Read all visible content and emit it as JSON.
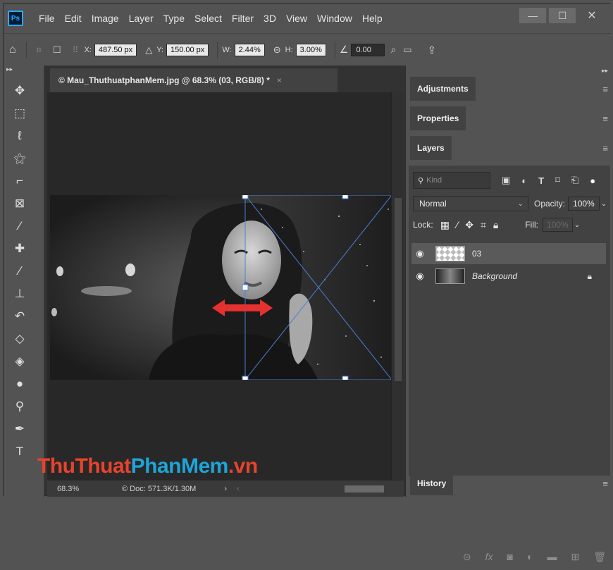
{
  "app": {
    "logo": "Ps",
    "menu": [
      "File",
      "Edit",
      "Image",
      "Layer",
      "Type",
      "Select",
      "Filter",
      "3D",
      "View",
      "Window",
      "Help"
    ],
    "window_buttons": [
      "—",
      "☐",
      "✕"
    ]
  },
  "options": {
    "x_label": "X:",
    "x_value": "487.50 px",
    "delta_label": "△",
    "y_label": "Y:",
    "y_value": "150.00 px",
    "w_label": "W:",
    "w_value": "2.44%",
    "link_icon": "link-icon",
    "h_label": "H:",
    "h_value": "3.00%",
    "angle_icon": "∠",
    "angle_value": "0.00"
  },
  "document": {
    "tab_title": "© Mau_ThuthuatphanMem.jpg @ 68.3% (03, RGB/8) *",
    "close": "×",
    "zoom": "68.3%",
    "doc_info": "© Doc: 571.3K/1.30M"
  },
  "panels": {
    "adjustments": "Adjustments",
    "properties": "Properties",
    "layers": "Layers",
    "history": "History",
    "filter_kind": "Kind",
    "blend_mode": "Normal",
    "opacity_label": "Opacity:",
    "opacity_value": "100%",
    "lock_label": "Lock:",
    "fill_label": "Fill:",
    "fill_value": "100%",
    "layers_list": [
      {
        "name": "03",
        "selected": true
      },
      {
        "name": "Background",
        "selected": false,
        "locked": true
      }
    ]
  },
  "watermark": {
    "part1": "ThuThuat",
    "part2": "PhanMem",
    "part3": ".vn",
    "colors": {
      "part1": "#e8432d",
      "part2": "#1ea5d8",
      "part3": "#e8432d"
    }
  },
  "colors": {
    "accent": "#31a8ff",
    "arrow": "#e5312f",
    "transform_box": "#4a7fd4"
  }
}
